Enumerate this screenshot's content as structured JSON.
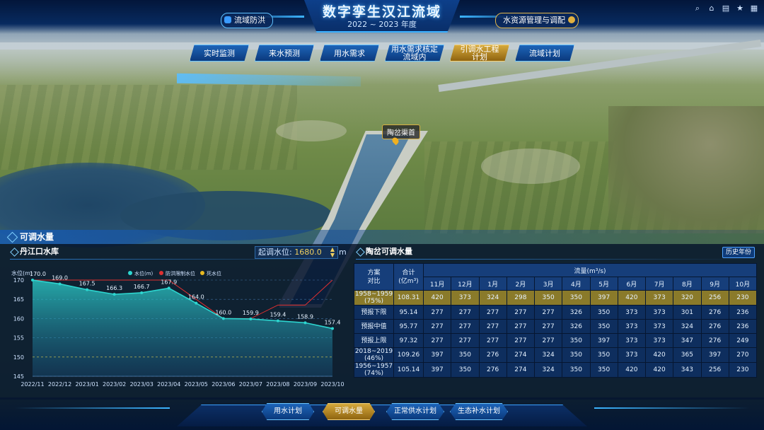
{
  "header": {
    "title": "数字孪生汉江流域",
    "year": "2022 ~ 2023 年度",
    "left_nav": "流域防洪",
    "right_nav": "水资源管理与调配"
  },
  "toolbar": {
    "icons": [
      "search-icon",
      "home-icon",
      "document-icon",
      "star-icon",
      "grid-icon"
    ]
  },
  "tabs": [
    {
      "label": "实时监测",
      "active": false
    },
    {
      "label": "来水预测",
      "active": false
    },
    {
      "label": "用水需求",
      "active": false
    },
    {
      "label": "用水需求核定\n流域内",
      "active": false
    },
    {
      "label": "引调水工程\n计划",
      "active": true
    },
    {
      "label": "流域计划",
      "active": false
    }
  ],
  "map": {
    "poi_label": "陶岔渠首"
  },
  "panel": {
    "title": "可调水量",
    "left": {
      "title": "丹江口水库",
      "start_level_label": "起调水位:",
      "start_level_value": "1680.0",
      "start_level_unit": "m"
    },
    "right": {
      "title": "陶岔可调水量",
      "history_button": "历史年份"
    }
  },
  "chart_data": {
    "type": "line",
    "ylabel": "水位(m)",
    "ylim": [
      145,
      170
    ],
    "yticks": [
      145,
      150,
      155,
      160,
      165,
      170
    ],
    "categories": [
      "2022/11",
      "2022/12",
      "2023/01",
      "2023/02",
      "2023/03",
      "2023/04",
      "2023/05",
      "2023/06",
      "2023/07",
      "2023/08",
      "2023/09",
      "2023/10"
    ],
    "legend": [
      "水位(m)",
      "防洪限制水位",
      "死水位"
    ],
    "series": [
      {
        "name": "水位(m)",
        "color": "#2dd6d0",
        "values": [
          170.0,
          169.0,
          167.5,
          166.3,
          166.7,
          167.9,
          164.0,
          160.0,
          159.9,
          159.4,
          158.9,
          157.4
        ],
        "labels": [
          "170.0",
          "169.0",
          "167.5",
          "166.3",
          "166.7",
          "167.9",
          "164.0",
          "160.0",
          "159.9",
          "159.4",
          "158.9",
          "157.4"
        ]
      },
      {
        "name": "防洪限制水位",
        "color": "#e03030",
        "values": [
          170,
          170,
          170,
          170,
          170,
          170,
          165,
          160,
          160,
          163.5,
          163.5,
          170
        ]
      },
      {
        "name": "死水位",
        "color": "#e8b820",
        "values": [
          150,
          150,
          150,
          150,
          150,
          150,
          150,
          150,
          150,
          150,
          150,
          150
        ]
      }
    ]
  },
  "table": {
    "head1": {
      "scheme": "方案",
      "compare": "对比",
      "total": "合计",
      "total_unit": "(亿m³)",
      "flow": "流量(m³/s)"
    },
    "months": [
      "11月",
      "12月",
      "1月",
      "2月",
      "3月",
      "4月",
      "5月",
      "6月",
      "7月",
      "8月",
      "9月",
      "10月"
    ],
    "rows": [
      {
        "name": "1958~1959\n(75%)",
        "total": "108.31",
        "values": [
          "420",
          "373",
          "324",
          "298",
          "350",
          "350",
          "397",
          "420",
          "373",
          "320",
          "256",
          "230"
        ],
        "highlight": true
      },
      {
        "name": "预报下限",
        "total": "95.14",
        "values": [
          "277",
          "277",
          "277",
          "277",
          "277",
          "326",
          "350",
          "373",
          "373",
          "301",
          "276",
          "236"
        ],
        "highlight": false
      },
      {
        "name": "预报中值",
        "total": "95.77",
        "values": [
          "277",
          "277",
          "277",
          "277",
          "277",
          "326",
          "350",
          "373",
          "373",
          "324",
          "276",
          "236"
        ],
        "highlight": false
      },
      {
        "name": "预报上限",
        "total": "97.32",
        "values": [
          "277",
          "277",
          "277",
          "277",
          "277",
          "350",
          "397",
          "373",
          "373",
          "347",
          "276",
          "249"
        ],
        "highlight": false
      },
      {
        "name": "2018~2019\n(46%)",
        "total": "109.26",
        "values": [
          "397",
          "350",
          "276",
          "274",
          "324",
          "350",
          "350",
          "373",
          "420",
          "365",
          "397",
          "270"
        ],
        "highlight": false
      },
      {
        "name": "1956~1957\n(74%)",
        "total": "105.14",
        "values": [
          "397",
          "350",
          "276",
          "274",
          "324",
          "350",
          "350",
          "420",
          "420",
          "343",
          "256",
          "230"
        ],
        "highlight": false
      }
    ]
  },
  "bottom_tabs": [
    {
      "label": "用水计划",
      "active": false
    },
    {
      "label": "可调水量",
      "active": true
    },
    {
      "label": "正常供水计划",
      "active": false
    },
    {
      "label": "生态补水计划",
      "active": false
    }
  ]
}
